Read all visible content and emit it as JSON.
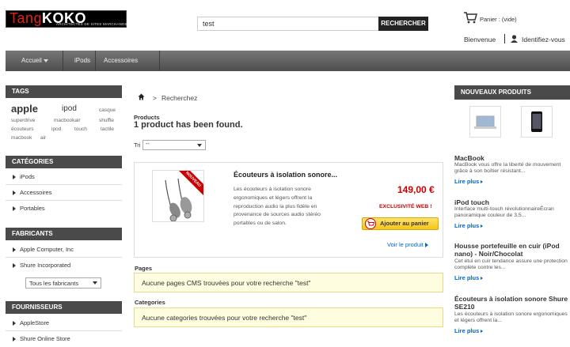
{
  "header": {
    "logo_text_left": "Tang",
    "logo_text_right": "KOKO",
    "logo_subtitle": "ARCHITECTES DE SITES MARCHANDS",
    "search_value": "test",
    "search_button": "RECHERCHER",
    "cart_label": "Panier : (vide)",
    "welcome": "Bienvenue",
    "identify": "Identifiez-vous"
  },
  "nav": {
    "items": [
      "Accueil",
      "iPods",
      "Accessoires"
    ]
  },
  "left": {
    "tags_title": "TAGS",
    "tags": [
      "apple",
      "ipod",
      "casque",
      "superdrive",
      "macbookair",
      "shuffle",
      "écouteurs",
      "ipod",
      "touch",
      "tactile",
      "macbook",
      "air"
    ],
    "categories_title": "CATÉGORIES",
    "categories": [
      "iPods",
      "Accessoires",
      "Portables"
    ],
    "manufacturers_title": "FABRICANTS",
    "manufacturers": [
      "Apple Computer, Inc",
      "Shure Incorporated"
    ],
    "manufacturers_select": "Tous les fabricants",
    "suppliers_title": "FOURNISSEURS",
    "suppliers": [
      "AppleStore",
      "Shure Online Store"
    ]
  },
  "main": {
    "breadcrumb_separator": ">",
    "breadcrumb": "Recherchez",
    "products_label": "Products",
    "found_text": "1 product has been found.",
    "sort_label": "Tri",
    "sort_value": "--",
    "product": {
      "badge": "NOUVEAU",
      "name": "Écouteurs à isolation sonore...",
      "desc": "Les écouteurs à isolation sonore ergonomiques et légers offrent la reproduction audio la plus fidèle en provenance de sources audio stéréo portables ou de salon.",
      "price": "149,00 €",
      "exclusive": "EXCLUSIVITÉ WEB !",
      "add_to_cart": "Ajouter au panier",
      "view": "Voir le produit"
    },
    "pages_label": "Pages",
    "pages_msg": "Aucune pages CMS trouvées pour votre recherche \"test\"",
    "categories_label": "Categories",
    "categories_msg": "Aucune categories trouvées pour votre recherche \"test\""
  },
  "right": {
    "title": "NOUVEAUX PRODUITS",
    "items": [
      {
        "title": "MacBook",
        "desc": "MacBook vous offre la liberté de mouvement grâce à son boîtier résistant..."
      },
      {
        "title": "iPod touch",
        "desc": "Interface multi-touch révolutionnaireÉcran panoramique couleur de 3,5..."
      },
      {
        "title": "Housse portefeuille en cuir (iPod nano) - Noir/Chocolat",
        "desc": "Cet étui en cuir tendance assure une protection complète contre les..."
      },
      {
        "title": "Écouteurs à isolation sonore Shure SE210",
        "desc": "Les écouteurs à isolation sonore ergonomiques et légers offrent la..."
      }
    ],
    "more": "Lire plus"
  },
  "colors": {
    "accent_red": "#cc0000",
    "link_blue": "#0066cc",
    "dark_bar": "#4a4a4a",
    "yellow_bg": "#fffde0",
    "cart_button": "#f5c518"
  }
}
